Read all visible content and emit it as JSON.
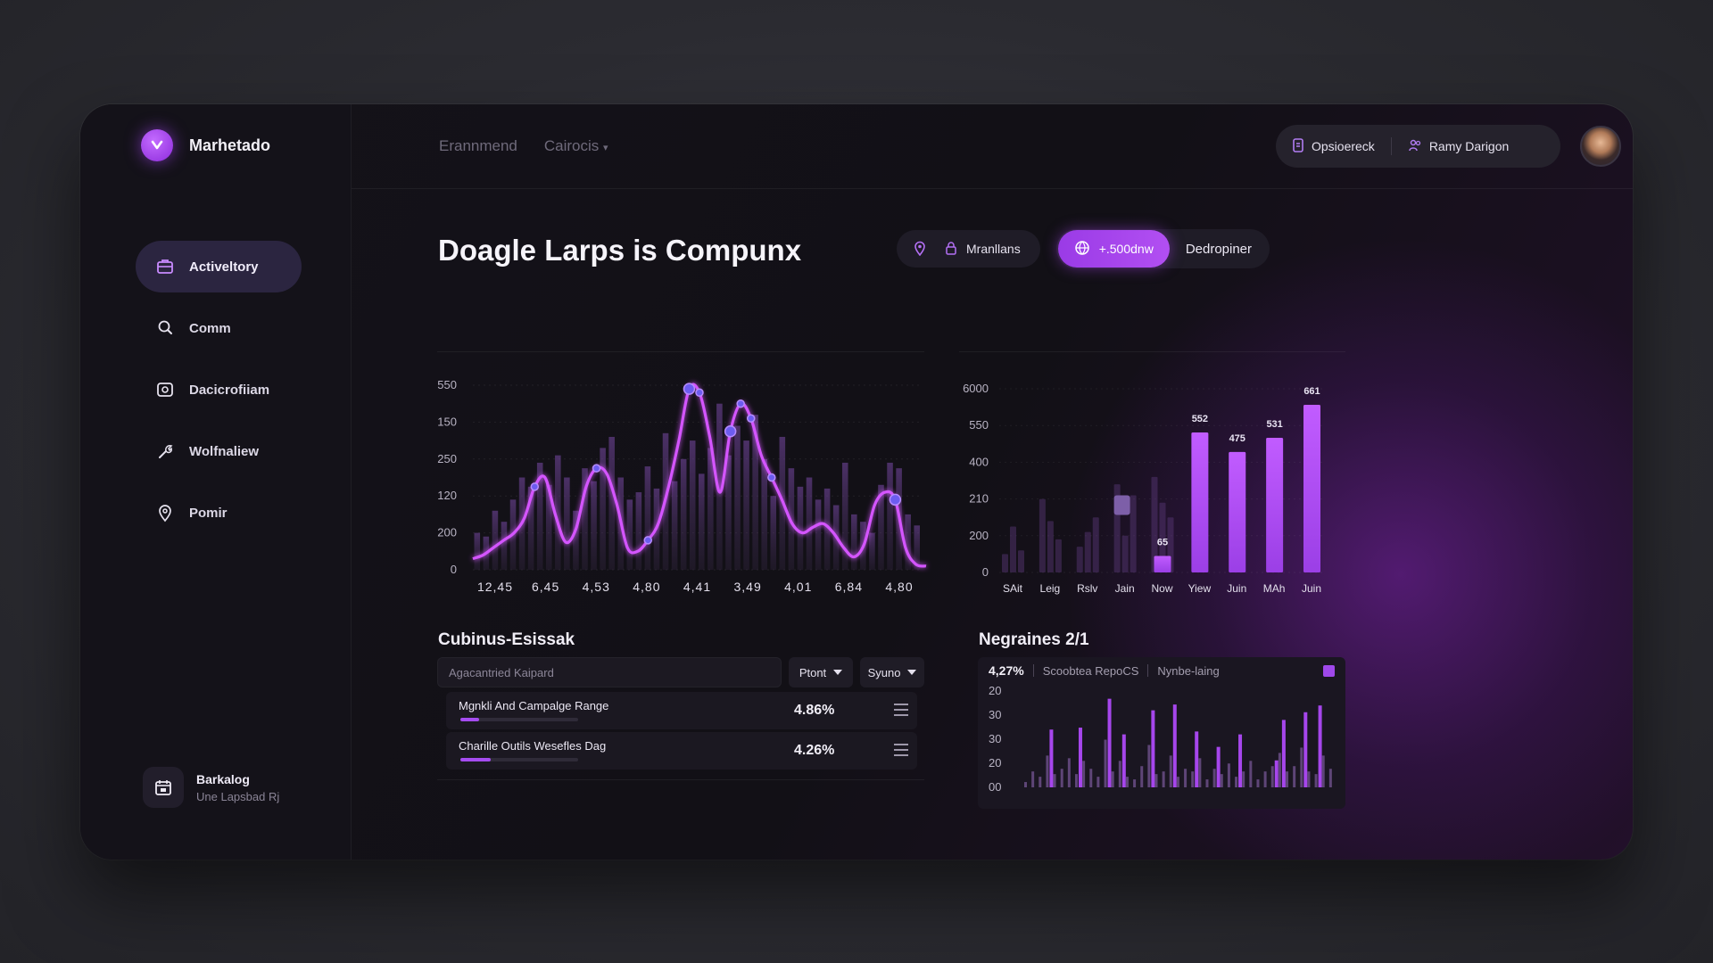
{
  "app": {
    "name": "Marhetado"
  },
  "topnav": {
    "links": [
      "Erannmend",
      "Cairocis"
    ]
  },
  "top_actions": {
    "first": "Opsioereck",
    "second": "Ramy Darigon"
  },
  "sidebar": {
    "items": [
      {
        "label": "Activeltory",
        "icon": "briefcase-icon",
        "active": true
      },
      {
        "label": "Comm",
        "icon": "search-icon",
        "active": false
      },
      {
        "label": "Dacicrofiiam",
        "icon": "camera-icon",
        "active": false
      },
      {
        "label": "Wolfnaliew",
        "icon": "wrench-icon",
        "active": false
      },
      {
        "label": "Pomir",
        "icon": "location-pin-icon",
        "active": false
      }
    ],
    "footer": {
      "title": "Barkalog",
      "subtitle": "Une Lapsbad Rj"
    }
  },
  "page": {
    "title": "Doagle Larps is Compunx"
  },
  "filters": {
    "location": "Mranllans",
    "accent": "+.500dnw",
    "plain": "Dedropiner"
  },
  "chart_data": [
    {
      "type": "line",
      "y_tick_labels": [
        "0",
        "200",
        "120",
        "250",
        "150",
        "550"
      ],
      "x_tick_labels": [
        "12,45",
        "6,45",
        "4,53",
        "4,80",
        "4,41",
        "3,49",
        "4,01",
        "6,84",
        "4,80"
      ],
      "series": [
        {
          "values": [
            0.06,
            0.08,
            0.12,
            0.16,
            0.2,
            0.28,
            0.45,
            0.5,
            0.3,
            0.15,
            0.22,
            0.45,
            0.55,
            0.52,
            0.35,
            0.12,
            0.1,
            0.16,
            0.25,
            0.45,
            0.7,
            0.98,
            0.96,
            0.72,
            0.42,
            0.75,
            0.9,
            0.82,
            0.62,
            0.5,
            0.38,
            0.25,
            0.2,
            0.23,
            0.25,
            0.2,
            0.12,
            0.07,
            0.14,
            0.35,
            0.42,
            0.38,
            0.12,
            0.03,
            0.02
          ]
        }
      ],
      "bar_values": [
        0.2,
        0.18,
        0.32,
        0.26,
        0.38,
        0.5,
        0.45,
        0.58,
        0.46,
        0.62,
        0.5,
        0.32,
        0.55,
        0.48,
        0.66,
        0.72,
        0.5,
        0.38,
        0.42,
        0.56,
        0.44,
        0.74,
        0.48,
        0.6,
        0.7,
        0.52,
        0.66,
        0.9,
        0.62,
        0.78,
        0.7,
        0.84,
        0.6,
        0.4,
        0.72,
        0.55,
        0.45,
        0.5,
        0.38,
        0.44,
        0.35,
        0.58,
        0.3,
        0.26,
        0.2,
        0.46,
        0.58,
        0.55,
        0.3,
        0.24
      ]
    },
    {
      "type": "bar",
      "y_tick_labels": [
        "0",
        "200",
        "210",
        "400",
        "550",
        "6000"
      ],
      "categories": [
        "SAit",
        "Leig",
        "Rslv",
        "Jain",
        "Now",
        "Yiew",
        "Juin",
        "MAh",
        "Juin"
      ],
      "bars": [
        {
          "value": 65,
          "label": "65"
        },
        {
          "value": 552,
          "label": "552"
        },
        {
          "value": 475,
          "label": "475"
        },
        {
          "value": 531,
          "label": "531"
        },
        {
          "value": 661,
          "label": "661"
        }
      ]
    }
  ],
  "table": {
    "title": "Cubinus-Esissak",
    "search_placeholder": "Agacantried Kaipard",
    "dropdown1": "Ptont",
    "dropdown2": "Syuno",
    "rows": [
      {
        "name": "Mgnkli And Campalge Range",
        "value": "4.86%",
        "progress": 0.16
      },
      {
        "name": "Charille Outils Wesefles Dag",
        "value": "4.26%",
        "progress": 0.26
      }
    ]
  },
  "bottom_panel": {
    "title": "Negraines 2/1",
    "stat": "4,27%",
    "label1": "Scoobtea RepoCS",
    "label2": "Nynbe-laing",
    "y_tick_labels": [
      "00",
      "20",
      "30",
      "30",
      "20"
    ]
  }
}
